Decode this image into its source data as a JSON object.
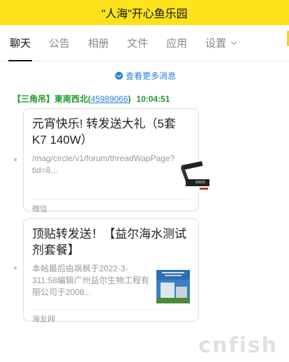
{
  "header": {
    "title": "\"人海\"开心鱼乐园"
  },
  "tabs": [
    {
      "label": "聊天"
    },
    {
      "label": "公告"
    },
    {
      "label": "相册"
    },
    {
      "label": "文件"
    },
    {
      "label": "应用"
    },
    {
      "label": "设置"
    }
  ],
  "chat": {
    "load_more": "查看更多消息",
    "sender": {
      "name": "【三角吊】東南西北",
      "qq": "45989066",
      "time": "10:04:51"
    },
    "messages": [
      {
        "title": "元宵快乐! 转发送大礼（5套K7 140W）",
        "desc": "/mag/circle/v1/forum/threadWapPage?tid=8...",
        "source": "微信",
        "thumb_icon": "lamp-thumbnail"
      },
      {
        "title": "顶贴转发送！【益尔海水测试剂套餐】",
        "desc": "本帖最后由飒枫于2022-3-311:58编辑广州益尔生物工程有限公司于2008...",
        "source": "海友网",
        "thumb_icon": "building-thumbnail"
      }
    ]
  },
  "watermark": "cnfish"
}
